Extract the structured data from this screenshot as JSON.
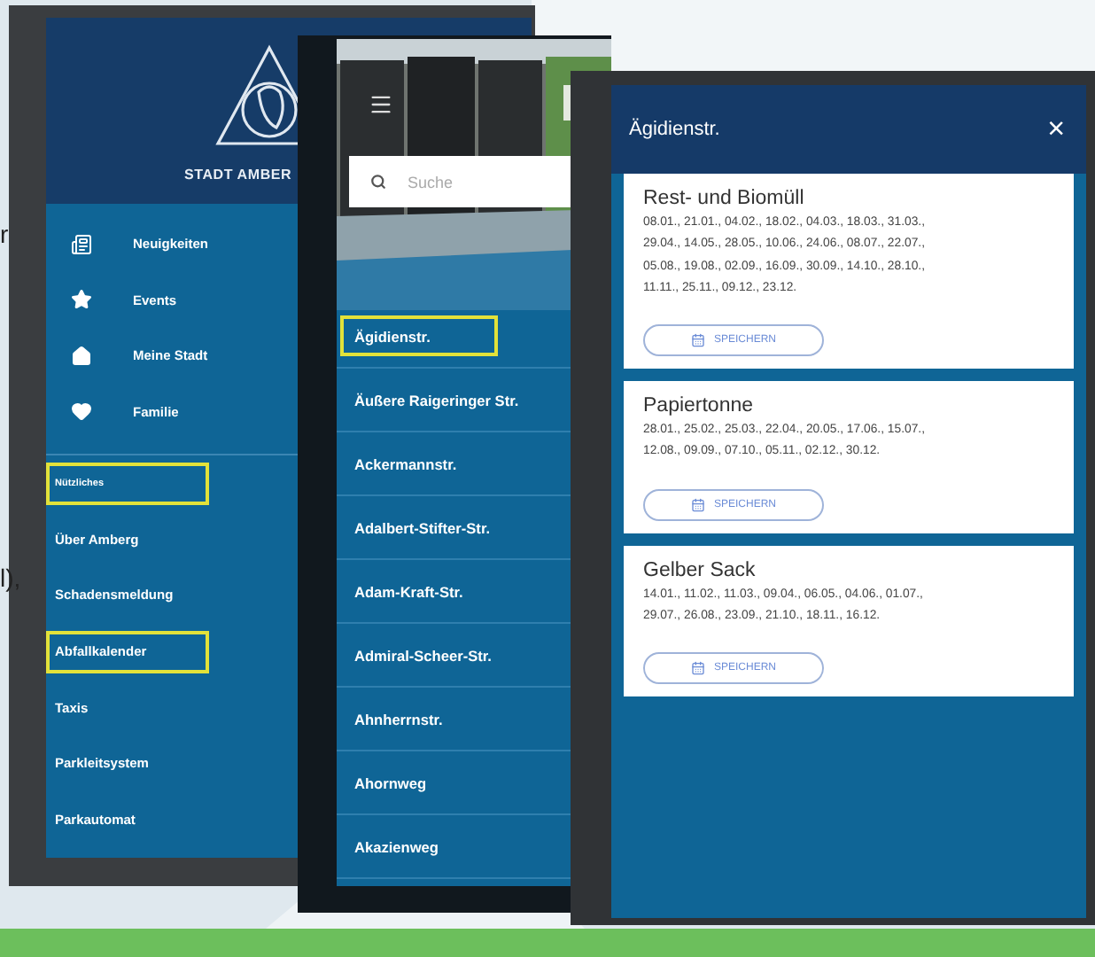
{
  "background_text": [
    "r",
    "l),"
  ],
  "menu_screen": {
    "brand": "STADT AMBER",
    "items": [
      {
        "kind": "primary",
        "label": "Neuigkeiten",
        "highlighted": false
      },
      {
        "kind": "primary",
        "label": "Events",
        "highlighted": false
      },
      {
        "kind": "primary",
        "label": "Meine Stadt",
        "highlighted": false
      },
      {
        "kind": "primary",
        "label": "Familie",
        "highlighted": false
      },
      {
        "kind": "section",
        "label": "Nützliches",
        "highlighted": true
      },
      {
        "kind": "link",
        "label": "Über Amberg",
        "highlighted": false
      },
      {
        "kind": "link",
        "label": "Schadensmeldung",
        "highlighted": false
      },
      {
        "kind": "link",
        "label": "Abfallkalender",
        "highlighted": true
      },
      {
        "kind": "link",
        "label": "Taxis",
        "highlighted": false
      },
      {
        "kind": "link",
        "label": "Parkleitsystem",
        "highlighted": false
      },
      {
        "kind": "link",
        "label": "Parkautomat",
        "highlighted": false
      }
    ]
  },
  "street_screen": {
    "search": {
      "placeholder": "Suche"
    },
    "streets": [
      {
        "label": "Ägidienstr.",
        "highlighted": true
      },
      {
        "label": "Äußere Raigeringer Str.",
        "highlighted": false
      },
      {
        "label": "Ackermannstr.",
        "highlighted": false
      },
      {
        "label": "Adalbert-Stifter-Str.",
        "highlighted": false
      },
      {
        "label": "Adam-Kraft-Str.",
        "highlighted": false
      },
      {
        "label": "Admiral-Scheer-Str.",
        "highlighted": false
      },
      {
        "label": "Ahnherrnstr.",
        "highlighted": false
      },
      {
        "label": "Ahornweg",
        "highlighted": false
      },
      {
        "label": "Akazienweg",
        "highlighted": false
      }
    ]
  },
  "detail_screen": {
    "title": "Ägidienstr.",
    "close": "×",
    "cards": [
      {
        "title": "Rest- und Biomüll",
        "dates": [
          "08.01., 21.01., 04.02., 18.02., 04.03., 18.03., 31.03.,",
          "29.04., 14.05., 28.05., 10.06., 24.06., 08.07., 22.07.,",
          "05.08., 19.08., 02.09., 16.09., 30.09., 14.10., 28.10.,",
          "11.11., 25.11., 09.12., 23.12."
        ],
        "button": "SPEICHERN"
      },
      {
        "title": "Papiertonne",
        "dates": [
          "28.01., 25.02., 25.03., 22.04., 20.05., 17.06., 15.07.,",
          "12.08., 09.09., 07.10., 05.11., 02.12., 30.12."
        ],
        "button": "SPEICHERN"
      },
      {
        "title": "Gelber Sack",
        "dates": [
          "14.01., 11.02., 11.03., 09.04., 06.05., 04.06., 01.07.,",
          "29.07., 26.08., 23.09., 21.10., 18.11., 16.12."
        ],
        "button": "SPEICHERN"
      }
    ]
  }
}
